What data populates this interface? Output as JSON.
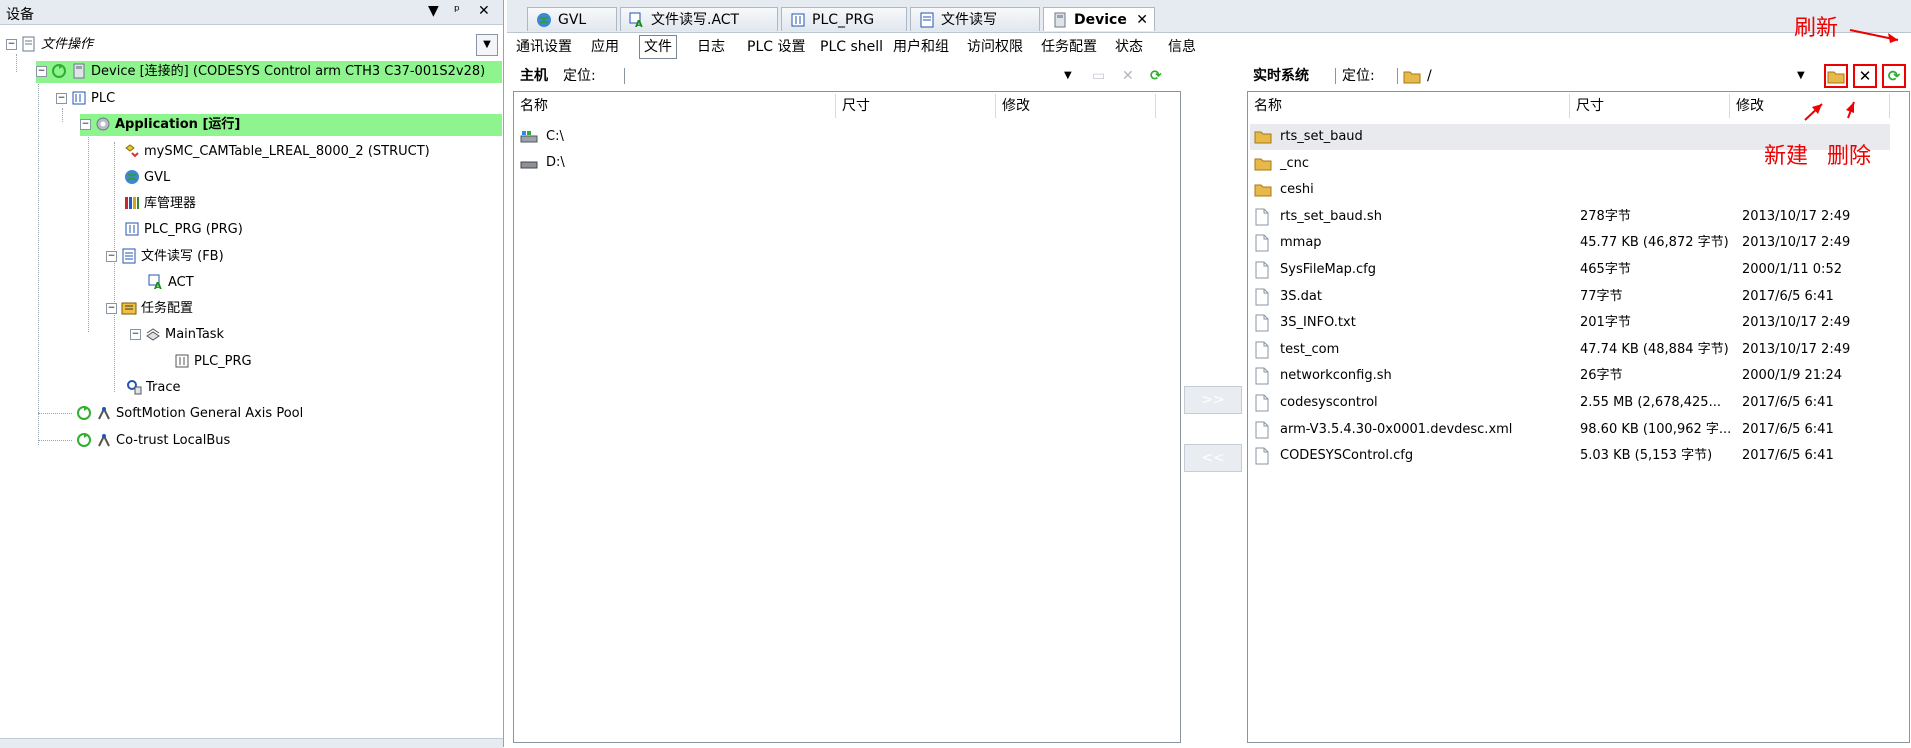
{
  "left_panel": {
    "title": "设备",
    "pin": "ᵖ",
    "close": "✕",
    "dropdown": "▼",
    "tree": [
      {
        "label": "文件操作",
        "italic": true
      },
      {
        "label": "Device [连接的] (CODESYS Control arm CTH3 C37-001S2v28)",
        "highlight": true
      },
      {
        "label": "PLC"
      },
      {
        "label": "Application [运行]",
        "highlight": true,
        "bold": true
      },
      {
        "label": "mySMC_CAMTable_LREAL_8000_2 (STRUCT)"
      },
      {
        "label": "GVL"
      },
      {
        "label": "库管理器"
      },
      {
        "label": "PLC_PRG (PRG)"
      },
      {
        "label": "文件读写 (FB)"
      },
      {
        "label": "ACT"
      },
      {
        "label": "任务配置"
      },
      {
        "label": "MainTask"
      },
      {
        "label": "PLC_PRG"
      },
      {
        "label": "Trace"
      },
      {
        "label": "SoftMotion General Axis Pool"
      },
      {
        "label": "Co-trust LocalBus"
      }
    ]
  },
  "doc_tabs": [
    {
      "label": "GVL"
    },
    {
      "label": "文件读写.ACT"
    },
    {
      "label": "PLC_PRG"
    },
    {
      "label": "文件读写"
    },
    {
      "label": "Device",
      "active": true,
      "close": "✕"
    }
  ],
  "sub_tabs": [
    "通讯设置",
    "应用",
    "文件",
    "日志",
    "PLC 设置",
    "PLC shell",
    "用户和组",
    "访问权限",
    "任务配置",
    "状态",
    "信息"
  ],
  "host_pane": {
    "title": "主机",
    "location_label": "定位:",
    "columns": [
      "名称",
      "尺寸",
      "修改"
    ],
    "items": [
      {
        "name": "C:\\"
      },
      {
        "name": "D:\\"
      }
    ]
  },
  "transfer": {
    "to_runtime": ">>",
    "to_host": "<<"
  },
  "runtime_pane": {
    "title": "实时系统",
    "location_label": "定位:",
    "path": "/",
    "columns": [
      "名称",
      "尺寸",
      "修改"
    ],
    "items": [
      {
        "name": "rts_set_baud",
        "type": "folder",
        "size": "",
        "modified": ""
      },
      {
        "name": "_cnc",
        "type": "folder",
        "size": "",
        "modified": ""
      },
      {
        "name": "ceshi",
        "type": "folder",
        "size": "",
        "modified": ""
      },
      {
        "name": "rts_set_baud.sh",
        "type": "file",
        "size": "278字节",
        "modified": "2013/10/17 2:49"
      },
      {
        "name": "mmap",
        "type": "file",
        "size": "45.77 KB (46,872 字节)",
        "modified": "2013/10/17 2:49"
      },
      {
        "name": "SysFileMap.cfg",
        "type": "file",
        "size": "465字节",
        "modified": "2000/1/11 0:52"
      },
      {
        "name": "3S.dat",
        "type": "file",
        "size": "77字节",
        "modified": "2017/6/5 6:41"
      },
      {
        "name": "3S_INFO.txt",
        "type": "file",
        "size": "201字节",
        "modified": "2013/10/17 2:49"
      },
      {
        "name": "test_com",
        "type": "file",
        "size": "47.74 KB (48,884 字节)",
        "modified": "2013/10/17 2:49"
      },
      {
        "name": "networkconfig.sh",
        "type": "file",
        "size": "26字节",
        "modified": "2000/1/9 21:24"
      },
      {
        "name": "codesyscontrol",
        "type": "file",
        "size": "2.55 MB (2,678,425...",
        "modified": "2017/6/5 6:41"
      },
      {
        "name": "arm-V3.5.4.30-0x0001.devdesc.xml",
        "type": "file",
        "size": "98.60 KB (100,962 字...",
        "modified": "2017/6/5 6:41"
      },
      {
        "name": "CODESYSControl.cfg",
        "type": "file",
        "size": "5.03 KB (5,153 字节)",
        "modified": "2017/6/5 6:41"
      }
    ]
  },
  "annotations": {
    "refresh": "刷新",
    "new": "新建",
    "delete": "删除"
  },
  "colors": {
    "highlight": "#8ef58e",
    "annotation": "#e00000",
    "folder": "#e8b84a"
  }
}
